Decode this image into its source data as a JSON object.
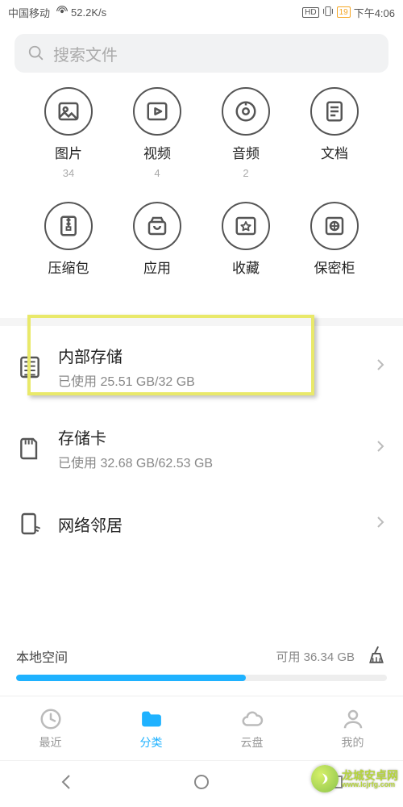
{
  "status": {
    "carrier": "中国移动",
    "signal": "⁴⁶",
    "net_speed": "52.2K/s",
    "hd": "HD",
    "battery": "19",
    "time": "下午4:06"
  },
  "search": {
    "placeholder": "搜索文件"
  },
  "categories": [
    {
      "key": "pictures",
      "label": "图片",
      "count": "34"
    },
    {
      "key": "videos",
      "label": "视频",
      "count": "4"
    },
    {
      "key": "audio",
      "label": "音频",
      "count": "2"
    },
    {
      "key": "docs",
      "label": "文档",
      "count": ""
    },
    {
      "key": "archives",
      "label": "压缩包",
      "count": ""
    },
    {
      "key": "apps",
      "label": "应用",
      "count": ""
    },
    {
      "key": "favorites",
      "label": "收藏",
      "count": ""
    },
    {
      "key": "safe",
      "label": "保密柜",
      "count": ""
    }
  ],
  "storage": {
    "internal": {
      "title": "内部存储",
      "sub": "已使用 25.51 GB/32 GB"
    },
    "sdcard": {
      "title": "存储卡",
      "sub": "已使用 32.68 GB/62.53 GB"
    },
    "network": {
      "title": "网络邻居"
    }
  },
  "space": {
    "label": "本地空间",
    "available": "可用 36.34 GB",
    "used_pct": 62
  },
  "tabs": [
    {
      "key": "recent",
      "label": "最近"
    },
    {
      "key": "category",
      "label": "分类"
    },
    {
      "key": "cloud",
      "label": "云盘"
    },
    {
      "key": "mine",
      "label": "我的"
    }
  ],
  "watermark": {
    "name": "龙城安卓网",
    "url": "www.lcjrfg.com"
  }
}
